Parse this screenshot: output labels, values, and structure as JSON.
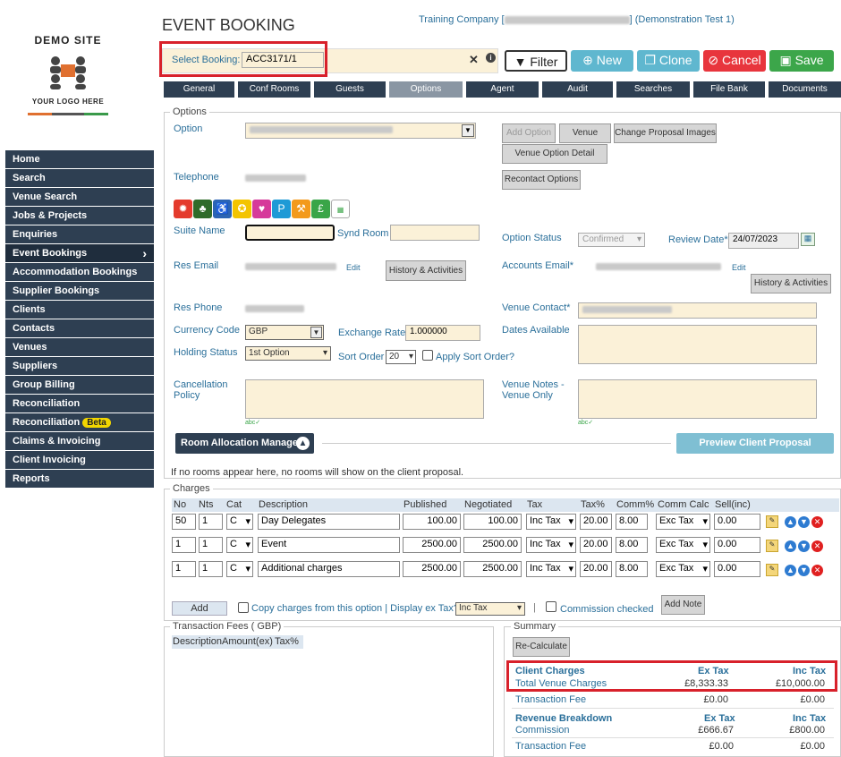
{
  "logo": {
    "title": "DEMO SITE",
    "subtitle": "YOUR LOGO HERE"
  },
  "sidebar": {
    "items": [
      {
        "label": "Home"
      },
      {
        "label": "Search"
      },
      {
        "label": "Venue Search"
      },
      {
        "label": "Jobs & Projects"
      },
      {
        "label": "Enquiries"
      },
      {
        "label": "Event Bookings"
      },
      {
        "label": "Accommodation Bookings"
      },
      {
        "label": "Supplier Bookings"
      },
      {
        "label": "Clients"
      },
      {
        "label": "Contacts"
      },
      {
        "label": "Venues"
      },
      {
        "label": "Suppliers"
      },
      {
        "label": "Group Billing"
      },
      {
        "label": "Reconciliation"
      },
      {
        "label": "Reconciliation",
        "badge": "Beta"
      },
      {
        "label": "Claims & Invoicing"
      },
      {
        "label": "Client Invoicing"
      },
      {
        "label": "Reports"
      }
    ]
  },
  "header": {
    "title": "EVENT BOOKING",
    "company_prefix": "Training Company [",
    "company_suffix": "] (Demonstration Test 1)"
  },
  "select_booking": {
    "label": "Select Booking:",
    "value": "ACC3171/1"
  },
  "toolbar": {
    "filter": "Filter",
    "new": "New",
    "clone": "Clone",
    "cancel": "Cancel",
    "save": "Save"
  },
  "tabs": [
    "General",
    "Conf Rooms",
    "Guests",
    "Options",
    "Agent",
    "Audit",
    "Searches",
    "File Bank",
    "Documents"
  ],
  "options": {
    "legend": "Options",
    "option_label": "Option",
    "add_option": "Add Option",
    "venue": "Venue",
    "change_images": "Change Proposal Images",
    "venue_option_detail": "Venue Option Detail",
    "recontact": "Recontact Options",
    "telephone": "Telephone",
    "suite_name": "Suite Name",
    "synd_room": "Synd Room",
    "option_status": "Option Status",
    "option_status_value": "Confirmed",
    "review_date": "Review Date*",
    "review_date_value": "24/07/2023",
    "res_email": "Res Email",
    "edit": "Edit",
    "history": "History & Activities",
    "accounts_email": "Accounts Email*",
    "res_phone": "Res Phone",
    "venue_contact": "Venue Contact*",
    "currency_code": "Currency Code",
    "currency_value": "GBP",
    "exchange_rate": "Exchange Rate",
    "exchange_value": "1.000000",
    "dates_available": "Dates Available",
    "holding_status": "Holding Status",
    "holding_value": "1st Option",
    "sort_order": "Sort Order",
    "sort_value": "20",
    "apply_sort": "Apply Sort Order?",
    "cancellation": "Cancellation Policy",
    "venue_notes": "Venue Notes - Venue Only",
    "room_alloc": "Room Allocation Manager",
    "preview": "Preview Client Proposal Document",
    "no_rooms": "If no rooms appear here, no rooms will show on the client proposal."
  },
  "charges": {
    "legend": "Charges",
    "headers": [
      "No",
      "Nts",
      "Cat",
      "Description",
      "Published",
      "Negotiated",
      "Tax",
      "Tax%",
      "Comm%",
      "Comm Calc",
      "Sell(inc)"
    ],
    "rows": [
      {
        "no": "50",
        "nts": "1",
        "cat": "C",
        "desc": "Day Delegates",
        "published": "100.00",
        "negotiated": "100.00",
        "tax": "Inc Tax",
        "taxpct": "20.00",
        "comm": "8.00",
        "calc": "Exc Tax",
        "sell": "0.00"
      },
      {
        "no": "1",
        "nts": "1",
        "cat": "C",
        "desc": "Event",
        "published": "2500.00",
        "negotiated": "2500.00",
        "tax": "Inc Tax",
        "taxpct": "20.00",
        "comm": "8.00",
        "calc": "Exc Tax",
        "sell": "0.00"
      },
      {
        "no": "1",
        "nts": "1",
        "cat": "C",
        "desc": "Additional charges",
        "published": "2500.00",
        "negotiated": "2500.00",
        "tax": "Inc Tax",
        "taxpct": "20.00",
        "comm": "8.00",
        "calc": "Exc Tax",
        "sell": "0.00"
      }
    ],
    "add": "Add",
    "copy": "Copy charges from this option",
    "display_ex_tax": "Display ex Tax?",
    "display_value": "Inc Tax",
    "commission_checked": "Commission checked",
    "add_note": "Add Note"
  },
  "transaction_fees": {
    "legend": "Transaction Fees ( GBP)",
    "headers": [
      "Description",
      "Amount(ex)",
      "Tax%"
    ]
  },
  "summary": {
    "legend": "Summary",
    "recalc": "Re-Calculate",
    "client_charges": "Client Charges",
    "ex_tax": "Ex Tax",
    "inc_tax": "Inc Tax",
    "total_venue": "Total Venue Charges",
    "total_ex": "£8,333.33",
    "total_inc": "£10,000.00",
    "txn_fee": "Transaction Fee",
    "txn_ex": "£0.00",
    "txn_inc": "£0.00",
    "revenue": "Revenue Breakdown",
    "commission": "Commission",
    "comm_ex": "£666.67",
    "comm_inc": "£800.00",
    "txn_fee2": "Transaction Fee",
    "txn2_ex": "£0.00",
    "txn2_inc": "£0.00"
  }
}
